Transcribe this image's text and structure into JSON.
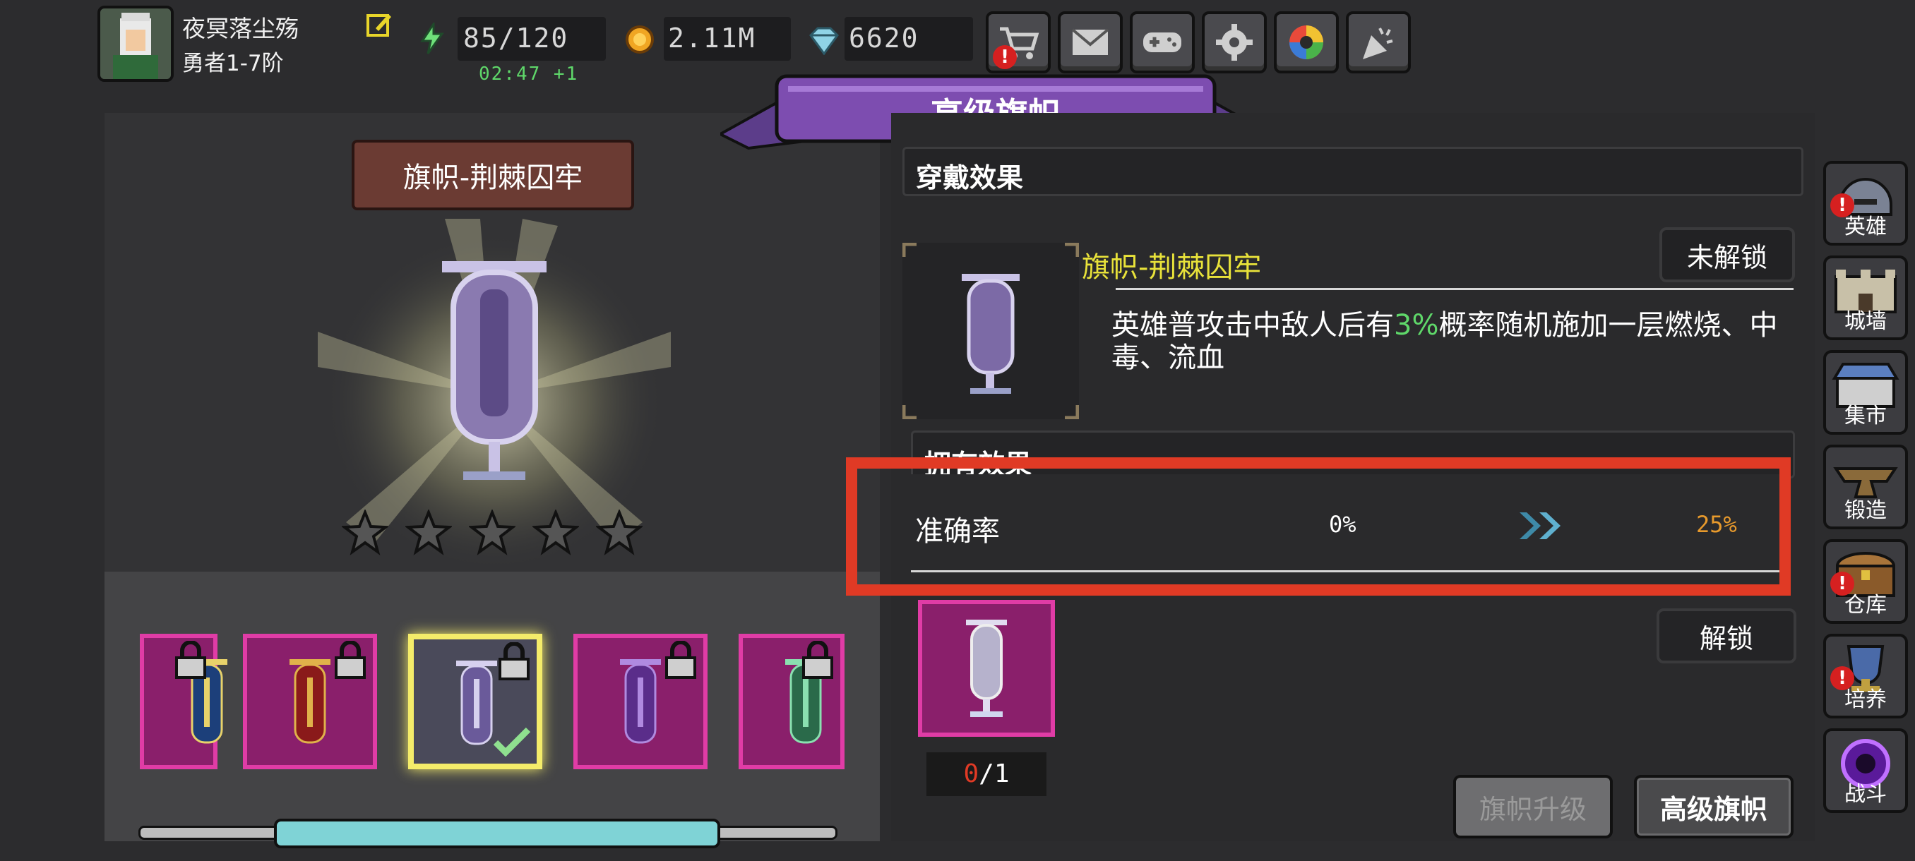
{
  "player": {
    "name": "夜冥落尘殇",
    "rank": "勇者1-7阶"
  },
  "resources": {
    "energy": "85/120",
    "energy_timer": "02:47 +1",
    "gold": "2.11M",
    "gems": "6620"
  },
  "top_buttons": [
    "shop-icon",
    "mail-icon",
    "gamepad-icon",
    "gear-icon",
    "camera-shutter-icon",
    "party-popper-icon"
  ],
  "page": {
    "title": "高级旗帜"
  },
  "left": {
    "banner_name": "旗帜-荆棘囚牢",
    "stars": 5,
    "slots": [
      "crescent-banner",
      "red-cross-banner",
      "violet-banner",
      "purple-claw-banner",
      "green-banner"
    ],
    "selected_slot": 2
  },
  "wear": {
    "section_label": "穿戴效果",
    "item_name": "旗帜-荆棘囚牢",
    "status": "未解锁",
    "desc_pre": "英雄普攻击中敌人后有",
    "desc_pct": "3%",
    "desc_post": "概率随机施加一层燃烧、中毒、流血"
  },
  "own": {
    "section_label": "拥有效果",
    "stat_name": "准确率",
    "stat_from": "0%",
    "stat_to": "25%",
    "count_have": "0",
    "count_need": "/1",
    "unlock_label": "解锁"
  },
  "actions": {
    "upgrade_label": "旗帜升级",
    "advanced_label": "高级旗帜"
  },
  "sidebar": [
    {
      "label": "英雄",
      "icon": "helmet-icon",
      "alert": true
    },
    {
      "label": "城墙",
      "icon": "wall-icon",
      "alert": false
    },
    {
      "label": "集市",
      "icon": "market-icon",
      "alert": false
    },
    {
      "label": "锻造",
      "icon": "anvil-icon",
      "alert": false
    },
    {
      "label": "仓库",
      "icon": "chest-icon",
      "alert": true
    },
    {
      "label": "培养",
      "icon": "trophy-icon",
      "alert": true
    },
    {
      "label": "战斗",
      "icon": "portal-icon",
      "alert": false
    }
  ],
  "colors": {
    "accent_purple": "#7d4db0",
    "highlight_yellow": "#e8e23a",
    "value_orange": "#e89a2c",
    "pct_green": "#5fd86a",
    "alert_red": "#e03a25",
    "slot_magenta": "#8a1f6b"
  }
}
